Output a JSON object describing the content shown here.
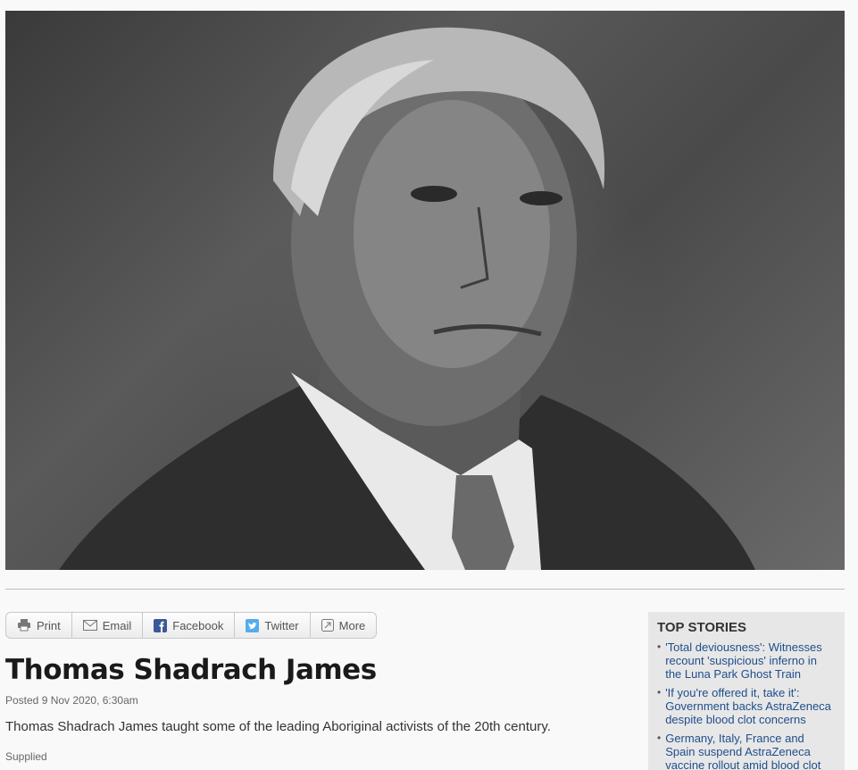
{
  "share_bar": {
    "print": "Print",
    "email": "Email",
    "facebook": "Facebook",
    "twitter": "Twitter",
    "more": "More"
  },
  "article": {
    "headline": "Thomas Shadrach James",
    "posted": "Posted 9 Nov 2020, 6:30am",
    "caption": "Thomas Shadrach James taught some of the leading Aboriginal activists of the 20th century.",
    "credit": "Supplied"
  },
  "top_stories": {
    "title": "TOP STORIES",
    "items": [
      "'Total deviousness': Witnesses recount 'suspicious' inferno in the Luna Park Ghost Train",
      "'If you're offered it, take it': Government backs AstraZeneca despite blood clot concerns",
      "Germany, Italy, France and Spain suspend AstraZeneca vaccine rollout amid blood clot"
    ]
  },
  "colors": {
    "link": "#1f4e8c",
    "facebook": "#3b5998",
    "twitter": "#55acee"
  }
}
